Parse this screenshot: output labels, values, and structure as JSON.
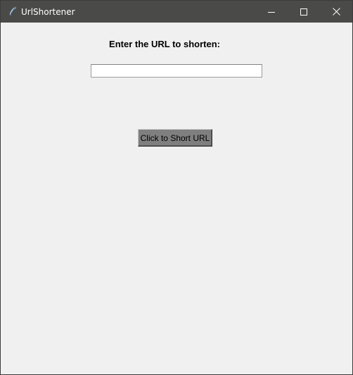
{
  "window": {
    "title": "UrlShortener",
    "icon": "feather-icon",
    "controls": {
      "minimize_icon": "minimize-icon",
      "maximize_icon": "maximize-icon",
      "close_icon": "close-icon"
    }
  },
  "form": {
    "prompt_label": "Enter the URL to shorten:",
    "url_input_value": "",
    "url_input_placeholder": "",
    "submit_label": "Click to Short URL"
  },
  "colors": {
    "titlebar": "#4a4a48",
    "background": "#f0f0f0",
    "button_face": "#7f7f7f"
  }
}
